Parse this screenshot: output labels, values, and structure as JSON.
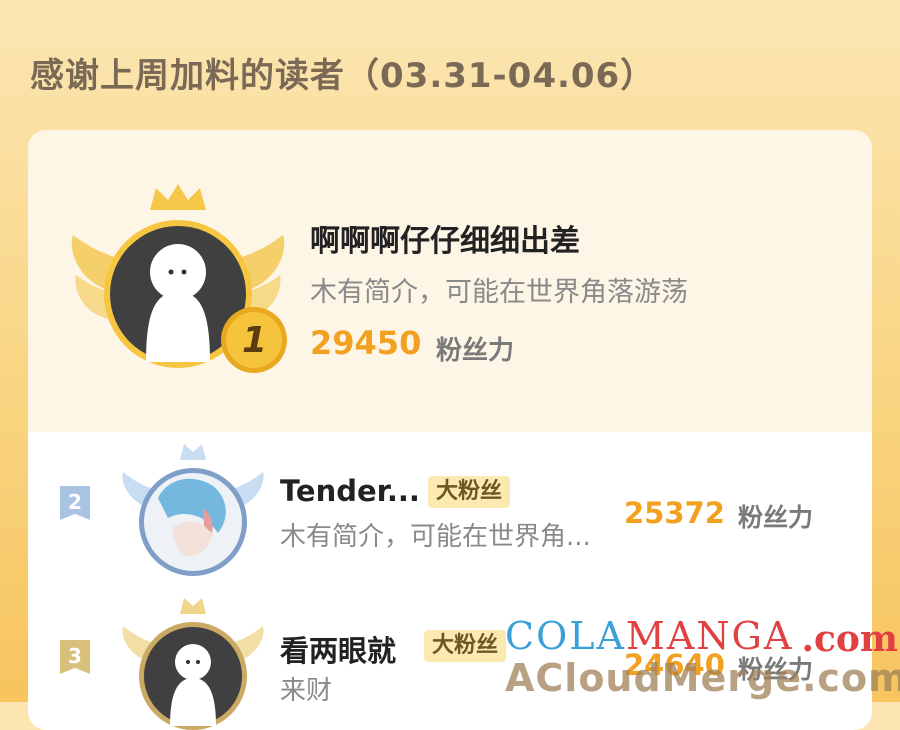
{
  "title": "感谢上周加料的读者（03.31-04.06）",
  "top_reader": {
    "rank": "1",
    "name": "啊啊啊仔仔细细出差",
    "bio": "木有简介，可能在世界角落游荡",
    "score": "29450",
    "score_unit": "粉丝力"
  },
  "readers": [
    {
      "rank": "2",
      "name": "Tender...",
      "tag": "大粉丝",
      "bio": "木有简介，可能在世界角...",
      "score": "25372",
      "score_unit": "粉丝力"
    },
    {
      "rank": "3",
      "name": "看两眼就",
      "tag": "大粉丝",
      "bio": "来财",
      "score": "24640",
      "score_unit": "粉丝力"
    }
  ],
  "watermark": {
    "line1_a": "COLA",
    "line1_b": "MANGA",
    "line1_c": ".com",
    "line2": "ACloudMerge.com"
  },
  "colors": {
    "gold": "#f2a020",
    "rank2": "#a9c3e3",
    "rank3": "#d8c07a"
  }
}
